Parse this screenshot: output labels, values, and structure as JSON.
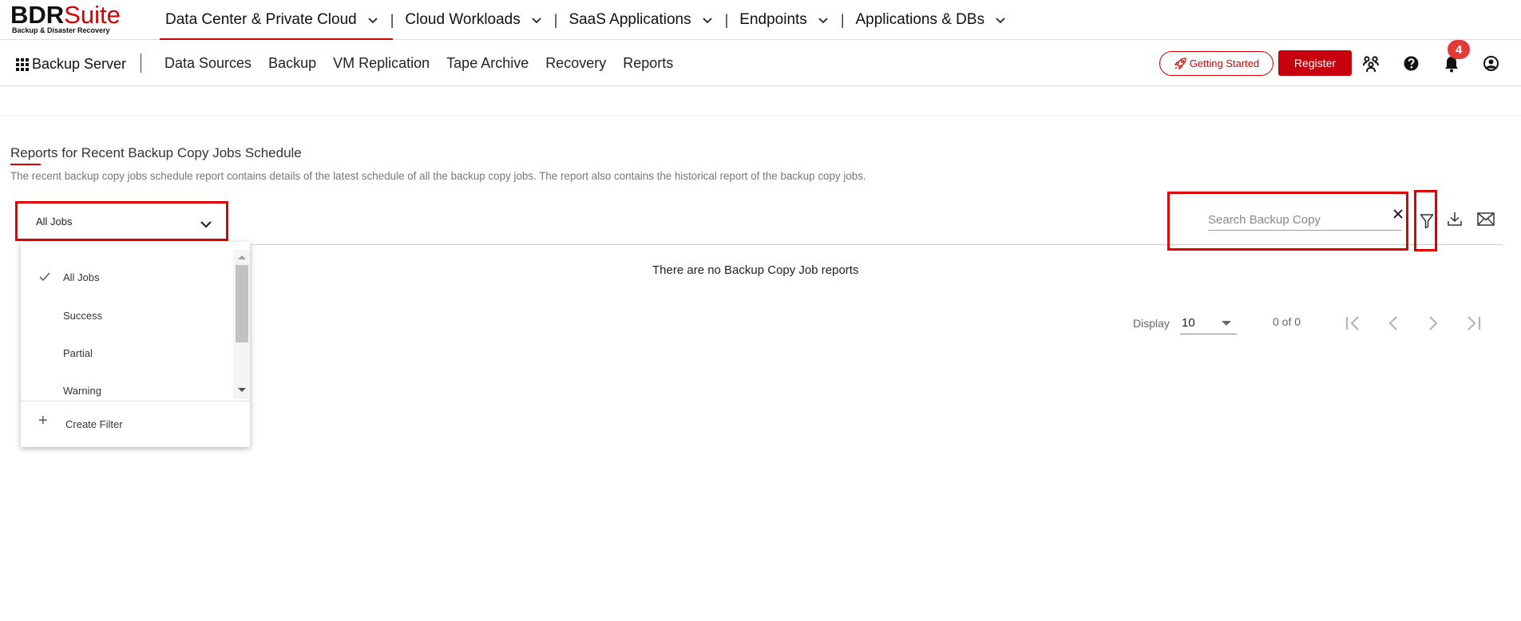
{
  "brand": {
    "logo_main": "BDR",
    "logo_accent": "Suite",
    "logo_tagline": "Backup & Disaster Recovery"
  },
  "top_nav": {
    "items": [
      {
        "label": "Data Center & Private Cloud",
        "icon": "chevron-down-icon"
      },
      {
        "label": "Cloud Workloads",
        "icon": "chevron-down-icon"
      },
      {
        "label": "SaaS Applications",
        "icon": "chevron-down-icon"
      },
      {
        "label": "Endpoints",
        "icon": "chevron-down-icon"
      },
      {
        "label": "Applications & DBs",
        "icon": "chevron-down-icon"
      }
    ],
    "separator": "|"
  },
  "sub_nav": {
    "app_label": "Backup Server",
    "items": [
      "Data Sources",
      "Backup",
      "VM Replication",
      "Tape Archive",
      "Recovery",
      "Reports"
    ],
    "getting_started": "Getting Started",
    "register": "Register",
    "notifications_count": "4",
    "icons": [
      "apps-grid-icon",
      "rocket-icon",
      "community-icon",
      "help-icon",
      "bell-icon",
      "user-icon"
    ]
  },
  "page": {
    "title": "Reports for Recent Backup Copy Jobs Schedule",
    "description": "The recent backup copy jobs schedule report contains details of the latest schedule of all the backup copy jobs. The report also contains the historical report of the backup copy jobs."
  },
  "job_filter": {
    "selected": "All Jobs",
    "options": [
      {
        "label": "All Jobs",
        "checked": true
      },
      {
        "label": "Success",
        "checked": false
      },
      {
        "label": "Partial",
        "checked": false
      },
      {
        "label": "Warning",
        "checked": false
      }
    ],
    "create_filter": "Create Filter"
  },
  "search": {
    "placeholder": "Search Backup Copy",
    "value": ""
  },
  "table": {
    "empty_message": "There are no Backup Copy Job reports"
  },
  "pagination": {
    "display_label": "Display",
    "page_size": "10",
    "range": "0 of 0"
  },
  "colors": {
    "brand_red": "#d40000",
    "register_bg": "#c8000e",
    "highlight_border": "#e00000",
    "badge": "#e53935"
  }
}
